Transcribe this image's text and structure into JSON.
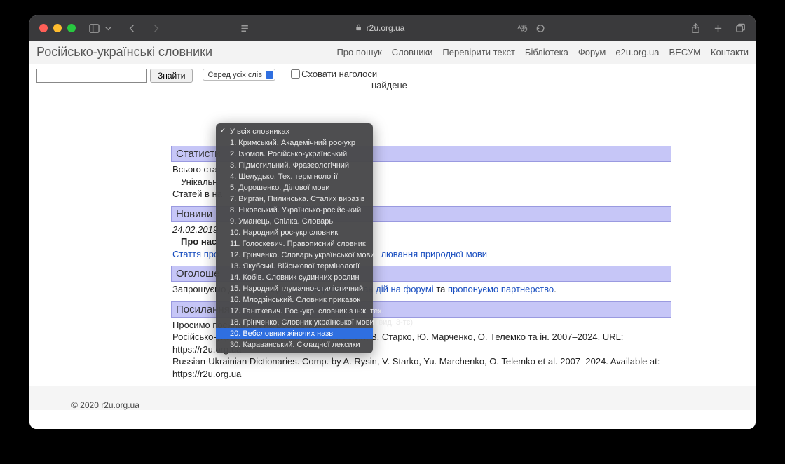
{
  "browser": {
    "url_host": "r2u.org.ua"
  },
  "header": {
    "site_title": "Російсько-українські словники",
    "nav": [
      "Про пошук",
      "Словники",
      "Перевірити текст",
      "Бібліотека",
      "Форум",
      "e2u.org.ua",
      "ВЕСУМ",
      "Контакти"
    ]
  },
  "search": {
    "button": "Знайти",
    "mode_select": "Серед усіх слів",
    "hide_accents": "Сховати наголоси",
    "found_fragment": "найдене"
  },
  "dropdown": {
    "items": [
      "У всіх словниках",
      "1. Кримський. Академічний рос-укр",
      "2. Ізюмов. Російсько-український",
      "3. Підмогильний. Фразеологічний",
      "4. Шелудько. Тех. термінології",
      "5. Дорошенко. Ділової мови",
      "7. Вирган, Пилинська. Сталих виразів",
      "8. Ніковський. Українсько-російський",
      "9. Уманець, Спілка. Словарь",
      "10. Народний рос-укр словник",
      "11. Голоскевич. Правописний словник",
      "12. Грінченко. Словарь української мови",
      "13. Якубські. Військової термінології",
      "14. Кобів. Словник судинних рослин",
      "15. Народний тлумачно-стилістичний",
      "16. Млодзінський. Словник приказок",
      "17. Ганіткевич. Рос.-укр. словник з інж. тех.",
      "18. Грінченко. Словник української мови (вид. 3-тє)",
      "20. Вебсловник жіночих назв",
      "30. Караванський. Складної лексики"
    ],
    "checked_index": 0,
    "highlighted_index": 18
  },
  "sections": {
    "stats": {
      "title": "Статисти",
      "line1": "Всього стат",
      "line2": "Унікальн",
      "line3": "Статей в на"
    },
    "news": {
      "title": "Новини",
      "date": "24.02.2019",
      "about": "Про нас",
      "article_prefix": "Стаття про",
      "article_link": "лювання природної мови"
    },
    "announce": {
      "title": "Оголоше",
      "body_prefix": "Запрошуємо до співпраці — ",
      "link1": "обговорюємо план дій на форумі",
      "mid": " та ",
      "link2": "пропонуємо партнерство",
      "body_suffix": "."
    },
    "refs": {
      "title": "Посилання",
      "line1": "Просимо посилатися на ресурс так:",
      "line2": "Російсько-українські словники / упор. А. Рисін, В. Старко, Ю. Марченко, О. Телемко та ін. 2007–2024. URL: https://r2u.org.ua",
      "line3": "Russian-Ukrainian Dictionaries. Comp. by A. Rysin, V. Starko, Yu. Marchenko, O. Telemko et al. 2007–2024. Available at: https://r2u.org.ua"
    }
  },
  "footer": "© 2020 r2u.org.ua"
}
